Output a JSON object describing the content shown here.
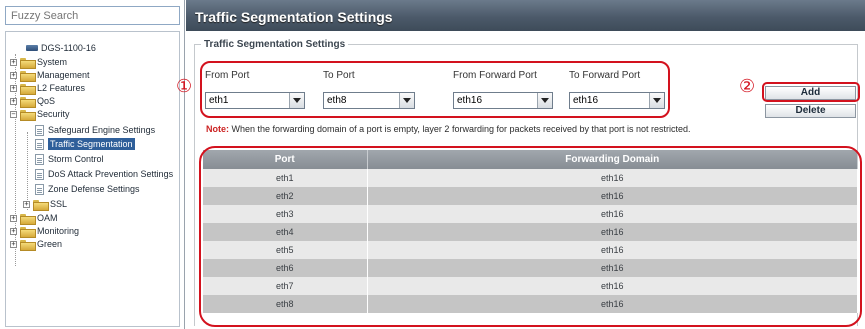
{
  "search": {
    "placeholder": "Fuzzy Search"
  },
  "tree": {
    "device": "DGS-1100-16",
    "items": [
      {
        "label": "System",
        "expander": "+"
      },
      {
        "label": "Management",
        "expander": "+"
      },
      {
        "label": "L2 Features",
        "expander": "+"
      },
      {
        "label": "QoS",
        "expander": "+"
      },
      {
        "label": "Security",
        "expander": "−"
      },
      {
        "label": "Safeguard Engine Settings"
      },
      {
        "label": "Traffic Segmentation"
      },
      {
        "label": "Storm Control"
      },
      {
        "label": "DoS Attack Prevention Settings"
      },
      {
        "label": "Zone Defense Settings"
      },
      {
        "label": "SSL",
        "expander": "+"
      },
      {
        "label": "OAM",
        "expander": "+"
      },
      {
        "label": "Monitoring",
        "expander": "+"
      },
      {
        "label": "Green",
        "expander": "+"
      }
    ]
  },
  "page": {
    "title": "Traffic Segmentation Settings",
    "section_legend": "Traffic Segmentation Settings"
  },
  "form": {
    "from_port": {
      "label": "From Port",
      "value": "eth1"
    },
    "to_port": {
      "label": "To Port",
      "value": "eth8"
    },
    "from_forward_port": {
      "label": "From Forward Port",
      "value": "eth16"
    },
    "to_forward_port": {
      "label": "To Forward Port",
      "value": "eth16"
    }
  },
  "buttons": {
    "add": "Add",
    "delete": "Delete"
  },
  "note": {
    "label": "Note:",
    "text": " When the forwarding domain of a port is empty, layer 2 forwarding for packets received by that port is not restricted."
  },
  "table": {
    "headers": [
      "Port",
      "Forwarding Domain"
    ],
    "rows": [
      [
        "eth1",
        "eth16"
      ],
      [
        "eth2",
        "eth16"
      ],
      [
        "eth3",
        "eth16"
      ],
      [
        "eth4",
        "eth16"
      ],
      [
        "eth5",
        "eth16"
      ],
      [
        "eth6",
        "eth16"
      ],
      [
        "eth7",
        "eth16"
      ],
      [
        "eth8",
        "eth16"
      ]
    ]
  },
  "callouts": {
    "one": "①",
    "two": "②"
  },
  "colors": {
    "title_bar": "#4c5a6a",
    "annotation": "#d3121e",
    "selected_node": "#2f5f9a",
    "note_label": "#cc2222"
  }
}
